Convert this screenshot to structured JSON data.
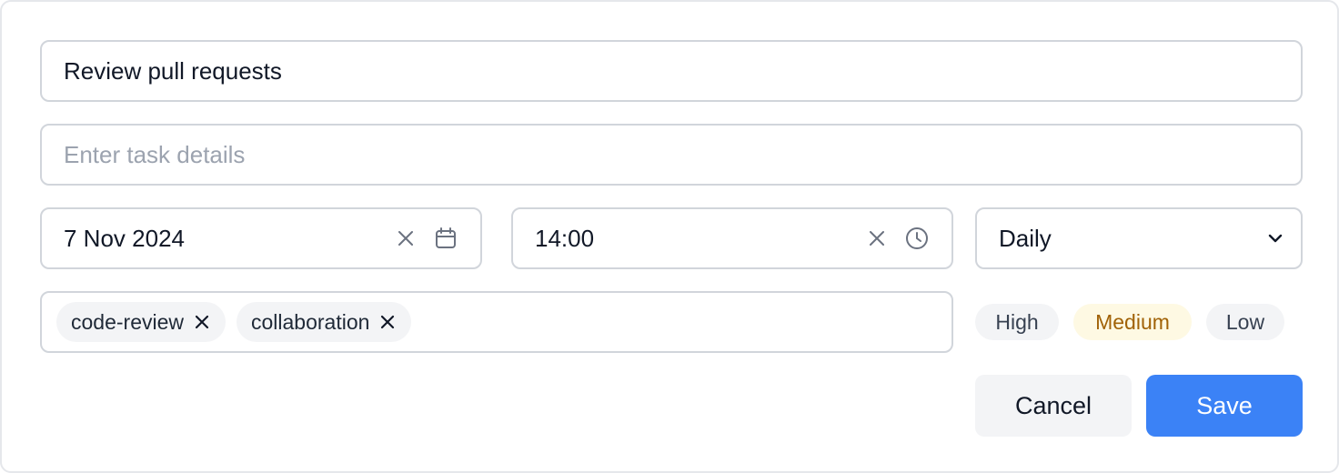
{
  "form": {
    "title_value": "Review pull requests",
    "details_placeholder": "Enter task details",
    "date_value": "7 Nov 2024",
    "time_value": "14:00",
    "repeat_value": "Daily",
    "tags": [
      {
        "label": "code-review",
        "icon": "close-icon"
      },
      {
        "label": "collaboration",
        "icon": "close-icon"
      }
    ],
    "priority": {
      "options": [
        "High",
        "Medium",
        "Low"
      ],
      "selected": "Medium",
      "selected_color": "#a16207",
      "selected_bg": "#fef9e3"
    },
    "actions": {
      "cancel_label": "Cancel",
      "save_label": "Save",
      "save_color": "#3b82f6"
    },
    "icons": {
      "date_clear": "close-icon",
      "date_picker": "calendar-icon",
      "time_clear": "close-icon",
      "time_picker": "clock-icon",
      "repeat_dropdown": "chevron-down-icon"
    }
  }
}
